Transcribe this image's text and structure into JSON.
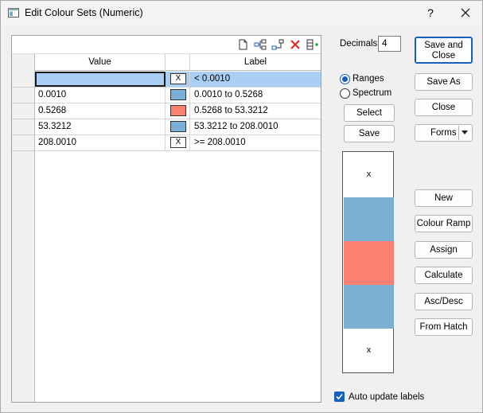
{
  "window": {
    "title": "Edit Colour Sets (Numeric)",
    "help_label": "?"
  },
  "grid": {
    "columns": {
      "value": "Value",
      "label": "Label"
    },
    "rows": [
      {
        "value": "",
        "swatch_text": "X",
        "swatch_color": null,
        "label": "< 0.0010",
        "selected": true
      },
      {
        "value": "0.0010",
        "swatch_text": "",
        "swatch_color": "#7bafd4",
        "label": "0.0010 to 0.5268"
      },
      {
        "value": "0.5268",
        "swatch_text": "",
        "swatch_color": "#fa8072",
        "label": "0.5268 to 53.3212"
      },
      {
        "value": "53.3212",
        "swatch_text": "",
        "swatch_color": "#7bafd4",
        "label": "53.3212 to 208.0010"
      },
      {
        "value": "208.0010",
        "swatch_text": "X",
        "swatch_color": null,
        "label": ">= 208.0010"
      }
    ]
  },
  "toolbar_icons": [
    "new-document-icon",
    "insert-row-icon",
    "append-row-icon",
    "delete-icon",
    "add-column-icon"
  ],
  "decimals": {
    "label": "Decimals",
    "value": "4"
  },
  "mode": {
    "ranges_label": "Ranges",
    "spectrum_label": "Spectrum",
    "selected": "Ranges"
  },
  "buttons": {
    "select": "Select",
    "save": "Save",
    "save_and_close_line1": "Save and",
    "save_and_close_line2": "Close",
    "save_as": "Save As",
    "close": "Close",
    "forms": "Forms",
    "new": "New",
    "colour_ramp": "Colour Ramp",
    "assign": "Assign",
    "calculate": "Calculate",
    "asc_desc": "Asc/Desc",
    "from_hatch": "From Hatch"
  },
  "preview": {
    "top_marker": "x",
    "bottom_marker": "x",
    "colors": {
      "blue": "#7bafd4",
      "salmon": "#fa8072"
    }
  },
  "auto_update": {
    "label": "Auto update labels",
    "checked": true
  },
  "accent_color": "#1560bd"
}
